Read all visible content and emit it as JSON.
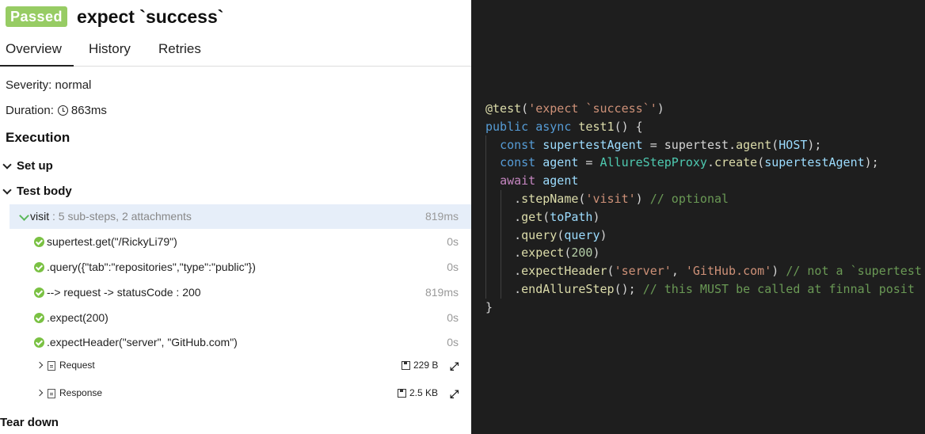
{
  "status_badge": "Passed",
  "test_title": "expect `success`",
  "tabs": [
    {
      "label": "Overview"
    },
    {
      "label": "History"
    },
    {
      "label": "Retries"
    }
  ],
  "severity_text": "Severity: normal",
  "duration": {
    "label": "Duration:",
    "value": "863ms"
  },
  "execution_heading": "Execution",
  "setup_label": "Set up",
  "test_body_label": "Test body",
  "teardown_label": "Tear down",
  "visit_step": {
    "name": "visit",
    "summary": " : 5 sub-steps, 2 attachments",
    "duration": "819ms"
  },
  "substeps": [
    {
      "label": "supertest.get(\"/RickyLi79\")",
      "duration": "0s"
    },
    {
      "label": ".query({\"tab\":\"repositories\",\"type\":\"public\"})",
      "duration": "0s"
    },
    {
      "label": "--> request -> statusCode : 200",
      "duration": "819ms"
    },
    {
      "label": ".expect(200)",
      "duration": "0s"
    },
    {
      "label": ".expectHeader(\"server\", \"GitHub.com\")",
      "duration": "0s"
    }
  ],
  "attachments": [
    {
      "name": "Request",
      "size": "229 B"
    },
    {
      "name": "Response",
      "size": "2.5 KB"
    }
  ],
  "icons": {
    "passed": "check-circle-icon",
    "duration": "clock-icon",
    "attachment": "file-icon",
    "size": "floppy-disk-icon",
    "expand": "expand-arrows-icon"
  },
  "colors": {
    "passed_badge": "#97cc64",
    "step_ok": "#7ac143",
    "selected_row": "#e6eef9",
    "code_bg": "#1e1e1e",
    "code_keyword": "#569cd6",
    "code_await": "#c586c0",
    "code_string": "#ce9178",
    "code_comment": "#6a9955",
    "code_function": "#dcdcaa",
    "code_class": "#4ec9b0",
    "code_variable": "#9cdcfe",
    "code_number": "#b5cea8",
    "code_default": "#d4d4d4"
  },
  "code": [
    [
      {
        "t": "@test",
        "c": "code_function"
      },
      {
        "t": "(",
        "c": "code_default"
      },
      {
        "t": "'expect `success`'",
        "c": "code_string"
      },
      {
        "t": ")",
        "c": "code_default"
      }
    ],
    [
      {
        "t": "public ",
        "c": "code_keyword"
      },
      {
        "t": "async ",
        "c": "code_keyword"
      },
      {
        "t": "test1",
        "c": "code_function"
      },
      {
        "t": "() {",
        "c": "code_default"
      }
    ],
    [
      {
        "t": "  ",
        "c": "code_default"
      },
      {
        "t": "const ",
        "c": "code_keyword"
      },
      {
        "t": "supertestAgent",
        "c": "code_variable"
      },
      {
        "t": " = ",
        "c": "code_default"
      },
      {
        "t": "supertest",
        "c": "code_default"
      },
      {
        "t": ".",
        "c": "code_default"
      },
      {
        "t": "agent",
        "c": "code_function"
      },
      {
        "t": "(",
        "c": "code_default"
      },
      {
        "t": "HOST",
        "c": "code_variable"
      },
      {
        "t": ");",
        "c": "code_default"
      }
    ],
    [
      {
        "t": "  ",
        "c": "code_default"
      },
      {
        "t": "const ",
        "c": "code_keyword"
      },
      {
        "t": "agent",
        "c": "code_variable"
      },
      {
        "t": " = ",
        "c": "code_default"
      },
      {
        "t": "AllureStepProxy",
        "c": "code_class"
      },
      {
        "t": ".",
        "c": "code_default"
      },
      {
        "t": "create",
        "c": "code_function"
      },
      {
        "t": "(",
        "c": "code_default"
      },
      {
        "t": "supertestAgent",
        "c": "code_variable"
      },
      {
        "t": ");",
        "c": "code_default"
      }
    ],
    [
      {
        "t": "  ",
        "c": "code_default"
      },
      {
        "t": "await ",
        "c": "code_await"
      },
      {
        "t": "agent",
        "c": "code_variable"
      }
    ],
    [
      {
        "t": "    .",
        "c": "code_default"
      },
      {
        "t": "stepName",
        "c": "code_function"
      },
      {
        "t": "(",
        "c": "code_default"
      },
      {
        "t": "'visit'",
        "c": "code_string"
      },
      {
        "t": ") ",
        "c": "code_default"
      },
      {
        "t": "// optional",
        "c": "code_comment"
      }
    ],
    [
      {
        "t": "    .",
        "c": "code_default"
      },
      {
        "t": "get",
        "c": "code_function"
      },
      {
        "t": "(",
        "c": "code_default"
      },
      {
        "t": "toPath",
        "c": "code_variable"
      },
      {
        "t": ")",
        "c": "code_default"
      }
    ],
    [
      {
        "t": "    .",
        "c": "code_default"
      },
      {
        "t": "query",
        "c": "code_function"
      },
      {
        "t": "(",
        "c": "code_default"
      },
      {
        "t": "query",
        "c": "code_variable"
      },
      {
        "t": ")",
        "c": "code_default"
      }
    ],
    [
      {
        "t": "    .",
        "c": "code_default"
      },
      {
        "t": "expect",
        "c": "code_function"
      },
      {
        "t": "(",
        "c": "code_default"
      },
      {
        "t": "200",
        "c": "code_number"
      },
      {
        "t": ")",
        "c": "code_default"
      }
    ],
    [
      {
        "t": "    .",
        "c": "code_default"
      },
      {
        "t": "expectHeader",
        "c": "code_function"
      },
      {
        "t": "(",
        "c": "code_default"
      },
      {
        "t": "'server'",
        "c": "code_string"
      },
      {
        "t": ", ",
        "c": "code_default"
      },
      {
        "t": "'GitHub.com'",
        "c": "code_string"
      },
      {
        "t": ") ",
        "c": "code_default"
      },
      {
        "t": "// not a `supertest",
        "c": "code_comment"
      }
    ],
    [
      {
        "t": "    .",
        "c": "code_default"
      },
      {
        "t": "endAllureStep",
        "c": "code_function"
      },
      {
        "t": "(); ",
        "c": "code_default"
      },
      {
        "t": "// this MUST be called at finnal posit",
        "c": "code_comment"
      }
    ],
    [
      {
        "t": "}",
        "c": "code_default"
      }
    ]
  ]
}
